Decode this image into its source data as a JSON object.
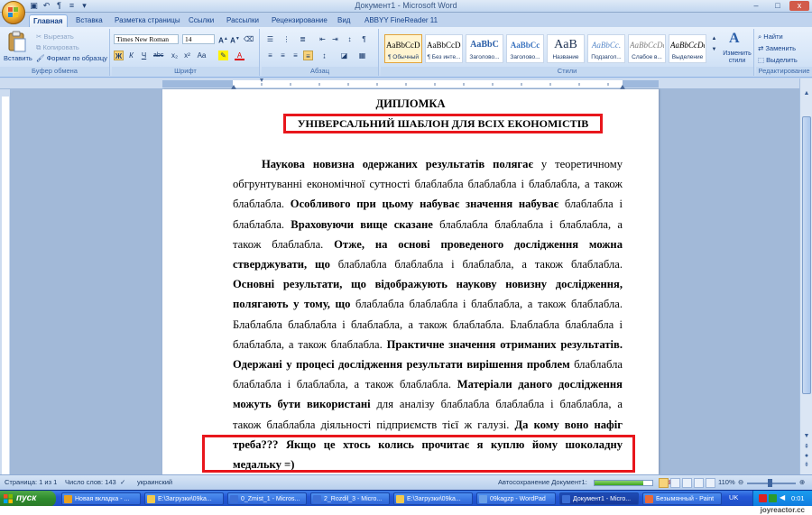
{
  "window": {
    "title": "Документ1 - Microsoft Word",
    "controls": {
      "minimize": "–",
      "maximize": "□",
      "close": "x"
    }
  },
  "tabs": [
    "Главная",
    "Вставка",
    "Разметка страницы",
    "Ссылки",
    "Рассылки",
    "Рецензирование",
    "Вид",
    "ABBYY FineReader 11"
  ],
  "active_tab": "Главная",
  "ribbon": {
    "clipboard": {
      "paste": "Вставить",
      "cut": "Вырезать",
      "copy": "Копировать",
      "format_painter": "Формат по образцу",
      "label": "Буфер обмена"
    },
    "font": {
      "name": "Times New Roman",
      "size": "14",
      "label": "Шрифт"
    },
    "paragraph": {
      "label": "Абзац"
    },
    "styles": {
      "label": "Стили",
      "items": [
        {
          "preview": "AaBbCcDc",
          "name": "¶ Обычный"
        },
        {
          "preview": "AaBbCcDc",
          "name": "¶ Без инте..."
        },
        {
          "preview": "AaBbC",
          "name": "Заголово..."
        },
        {
          "preview": "AaBbCc",
          "name": "Заголово..."
        },
        {
          "preview": "AaB",
          "name": "Название"
        },
        {
          "preview": "AaBbCc.",
          "name": "Подзагол..."
        },
        {
          "preview": "AaBbCcDc",
          "name": "Слабое в..."
        },
        {
          "preview": "AaBbCcDc",
          "name": "Выделение"
        }
      ],
      "change_styles": "Изменить стили"
    },
    "editing": {
      "find": "Найти",
      "replace": "Заменить",
      "select": "Выделить",
      "label": "Редактирование"
    }
  },
  "document": {
    "title1": "ДИПЛОМКА",
    "title2": "УНІВЕРСАЛЬНИЙ ШАБЛОН ДЛЯ ВСІХ ЕКОНОМІСТІВ",
    "paragraph_segments": [
      {
        "bold": true,
        "text": "Наукова новизна одержаних результатів полягає"
      },
      {
        "bold": false,
        "text": " у теоретичному обгрунтуванні економічної сутності блаблабла блаблабла і блаблабла, а також блаблабла. "
      },
      {
        "bold": true,
        "text": "Особливого при цьому набуває значення набуває"
      },
      {
        "bold": false,
        "text": " блаблабла і блаблабла. "
      },
      {
        "bold": true,
        "text": "Враховуючи вище сказане"
      },
      {
        "bold": false,
        "text": " блаблабла блаблабла і блаблабла, а також блаблабла. "
      },
      {
        "bold": true,
        "text": "Отже, на основі проведеного дослідження можна стверджувати, що"
      },
      {
        "bold": false,
        "text": " блаблабла блаблабла і блаблабла, а також блаблабла. "
      },
      {
        "bold": true,
        "text": "Основні результати, що відображують наукову новизну дослідження, полягають у тому, що"
      },
      {
        "bold": false,
        "text": " блаблабла блаблабла і блаблабла, а також блаблабла. Блаблабла блаблабла і блаблабла, а також блаблабла. Блаблабла блаблабла і блаблабла, а також блаблабла. "
      },
      {
        "bold": true,
        "text": "Практичне значення отриманих результатів. Одержані у процесі дослідження результати вирішення проблем"
      },
      {
        "bold": false,
        "text": " блаблабла блаблабла і блаблабла, а також блаблабла. "
      },
      {
        "bold": true,
        "text": "Матеріали даного дослідження можуть бути використані"
      },
      {
        "bold": false,
        "text": " для аналізу блаблабла блаблабла і блаблабла, а також блаблабла діяльності підприємств тієї ж галузі. "
      },
      {
        "bold": true,
        "text": "Да кому воно нафіг треба??? Якщо це хтось колись прочитає я куплю йому шоколадну медальку =)"
      }
    ]
  },
  "statusbar": {
    "page": "Страница: 1 из 1",
    "words": "Число слов: 143",
    "language": "украинский",
    "autosave": "Автосохранение Документ1:",
    "autosave_progress": 0.85,
    "zoom": "110%"
  },
  "taskbar": {
    "start": "пуск",
    "tasks": [
      {
        "label": "Новая вкладка - ...",
        "color": "#e8a020"
      },
      {
        "label": "E:\\Загрузки\\09ka...",
        "color": "#f2c94c"
      },
      {
        "label": "0_Zmist_1 - Micros...",
        "color": "#3c6fd6"
      },
      {
        "label": "2_Rozdil_3 - Micro...",
        "color": "#3c6fd6"
      },
      {
        "label": "E:\\Загрузки\\09ka...",
        "color": "#f2c94c"
      },
      {
        "label": "09kagzp - WordPad",
        "color": "#6aa0e8"
      },
      {
        "label": "Документ1 - Micro...",
        "color": "#3c6fd6"
      },
      {
        "label": "Безымянный - Paint",
        "color": "#e86a3a"
      }
    ],
    "active_task_index": 6,
    "lang": "UK",
    "clock": "0:01"
  },
  "watermark": "joyreactor.cc",
  "colors": {
    "highlight_box": "#e8161c",
    "ribbon_text": "#15428b"
  }
}
